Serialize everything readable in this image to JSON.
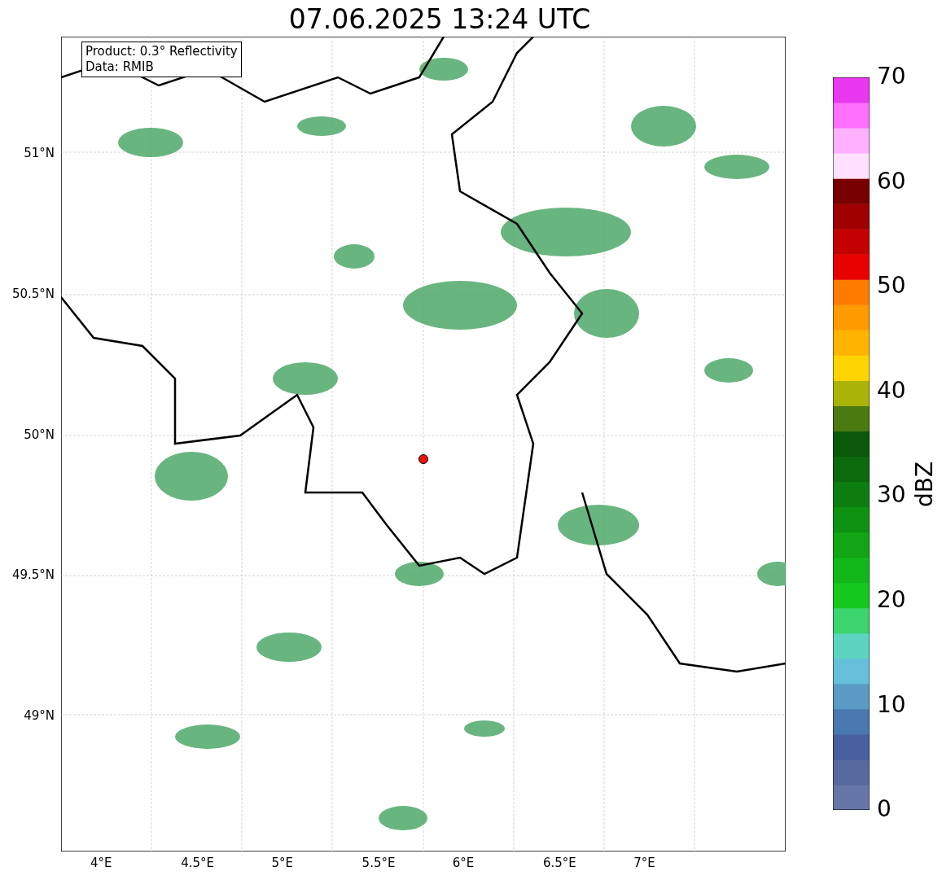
{
  "title": "07.06.2025 13:24 UTC",
  "legend": [
    "Product: 0.3° Reflectivity",
    "Data: RMIB"
  ],
  "lat_labels": [
    "51°N",
    "50.5°N",
    "50°N",
    "49.5°N",
    "49°N"
  ],
  "lon_labels": [
    "4°E",
    "4.5°E",
    "5°E",
    "5.5°E",
    "6°E",
    "6.5°E",
    "7°E"
  ],
  "colorbar": {
    "label": "dBZ",
    "ticks": [
      "70",
      "60",
      "50",
      "40",
      "30",
      "20",
      "10",
      "0"
    ]
  }
}
